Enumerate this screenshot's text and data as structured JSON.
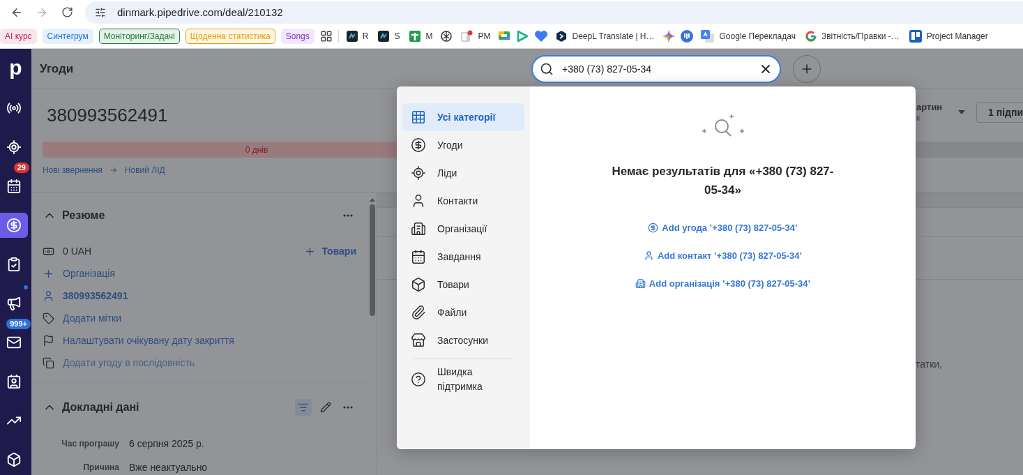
{
  "browser": {
    "url": "dinmark.pipedrive.com/deal/210132",
    "forward_disabled": true
  },
  "bookmarks": {
    "chips": [
      {
        "label": "AI курс",
        "color": "#c2185b",
        "outlined": false
      },
      {
        "label": "Синтегрум",
        "color": "#1a73e8",
        "outlined": false
      },
      {
        "label": "Моніторинг/Задачі",
        "color": "#188038",
        "outlined": true
      },
      {
        "label": "Щоденна статистика",
        "color": "#e8a000",
        "outlined": true
      },
      {
        "label": "Songs",
        "color": "#8430ce",
        "outlined": false
      }
    ],
    "links": [
      "R",
      "S",
      "M",
      "PM",
      "DeepL Translate | H…",
      "Google Перекладач",
      "Звітність/Правки -…",
      "Project Manager"
    ]
  },
  "nav": {
    "logo": "p",
    "items": [
      {
        "selected": false,
        "dot": false
      },
      {
        "selected": false,
        "dot": false
      },
      {
        "selected": false,
        "dot": false,
        "badge": "29"
      },
      {
        "selected": true,
        "dot": false
      },
      {
        "selected": false,
        "dot": false
      },
      {
        "selected": false,
        "dot": true
      },
      {
        "selected": false,
        "dot": false,
        "badge": "999+"
      },
      {
        "selected": false,
        "dot": false
      },
      {
        "selected": false,
        "dot": false
      },
      {
        "selected": false,
        "dot": false
      }
    ]
  },
  "header": {
    "title": "Угоди",
    "search": {
      "value": "+380 (73) 827-05-34"
    }
  },
  "deal": {
    "title": "380993562491",
    "stage_label": "0 днів",
    "breadcrumb": [
      "Нові звернення",
      "Новий ЛІД"
    ],
    "owner_fragment": "артин",
    "owner_sub_fragment": "к",
    "followers_button": "1 підпи"
  },
  "summary": {
    "title": "Резюме",
    "value": "0 UAH",
    "products_link": "Товари",
    "rows": [
      {
        "kind": "add",
        "label": "Організація",
        "bold": false,
        "disabled": false
      },
      {
        "kind": "person",
        "label": "380993562491",
        "bold": true,
        "disabled": false
      },
      {
        "kind": "tag",
        "label": "Додати мітки",
        "bold": false,
        "disabled": false
      },
      {
        "kind": "flag",
        "label": "Налаштувати очікувану дату закриття",
        "bold": false,
        "disabled": false
      },
      {
        "kind": "sequence",
        "label": "Додати угоду в послідовність",
        "bold": false,
        "disabled": true
      }
    ]
  },
  "details": {
    "title": "Докладні дані",
    "fields": [
      {
        "label": "Час програшу",
        "value": "6 серпня 2025 р."
      },
      {
        "label": "Причина",
        "value": "Вже неактуально"
      }
    ]
  },
  "right_panel": {
    "text_fragment": "татки,"
  },
  "search_dialog": {
    "categories": [
      {
        "label": "Усі категорії",
        "selected": true
      },
      {
        "label": "Угоди",
        "selected": false
      },
      {
        "label": "Ліди",
        "selected": false
      },
      {
        "label": "Контакти",
        "selected": false
      },
      {
        "label": "Організації",
        "selected": false
      },
      {
        "label": "Завдання",
        "selected": false
      },
      {
        "label": "Товари",
        "selected": false
      },
      {
        "label": "Файли",
        "selected": false
      },
      {
        "label": "Застосунки",
        "selected": false
      }
    ],
    "support": "Швидка підтримка",
    "empty_title": "Немає результатів для «+380 (73) 827-05-34»",
    "actions": [
      {
        "kind": "deal",
        "label": "Add угода ’+380 (73) 827-05-34’"
      },
      {
        "kind": "contact",
        "label": "Add контакт ’+380 (73) 827-05-34’"
      },
      {
        "kind": "organization",
        "label": "Add організація ’+380 (73) 827-05-34’"
      }
    ]
  }
}
